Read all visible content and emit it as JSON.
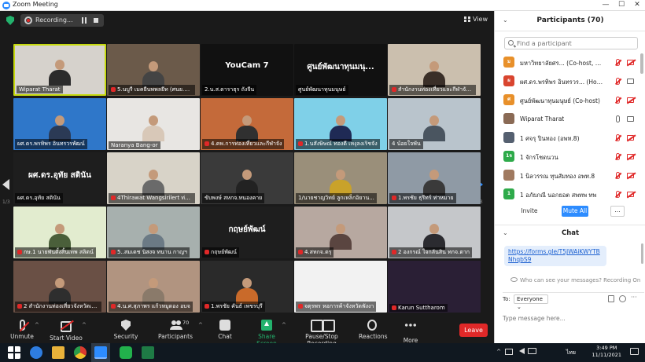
{
  "window": {
    "title": "Zoom Meeting",
    "minimize": "—",
    "maximize": "☐",
    "close": "✕"
  },
  "meeting_bar": {
    "recording_label": "Recording...",
    "view_label": "View"
  },
  "pagination": {
    "left_label": "1/3",
    "right_label": "1/3"
  },
  "tiles": [
    {
      "name": "Wiparat Tharat",
      "mic_off": false,
      "active": true,
      "bg": "#d6d2cc",
      "body": "#2b2b2b",
      "label": ""
    },
    {
      "name": "5.นบูรี เมคยีนพพลยีท (ศนย.พศ.ง...",
      "mic_off": true,
      "active": false,
      "bg": "#6b5a4a",
      "body": "#444",
      "label": ""
    },
    {
      "name": "2.น.ส.ดาราธุร ถังจีน",
      "mic_off": false,
      "active": false,
      "bg": "#111",
      "body": "",
      "label": "YouCam 7"
    },
    {
      "name": "ศูนย์พัฒนาทุนมนุษย์",
      "mic_off": false,
      "active": false,
      "bg": "#111",
      "body": "",
      "label": "ศูนย์พัฒนาทุนมนุ..."
    },
    {
      "name": "สำนักงานท่องเที่ยวและกีฬาจังหวั...",
      "mic_off": true,
      "active": false,
      "bg": "#cbbfae",
      "body": "#3a2f28",
      "label": ""
    },
    {
      "name": "ผศ.ดร.พรทิพร อินทรวรพัฒน์",
      "mic_off": false,
      "active": false,
      "bg": "#2f77c9",
      "body": "#2b3a55",
      "label": ""
    },
    {
      "name": "Naranya Bang-or",
      "mic_off": false,
      "active": false,
      "bg": "#e8e6e3",
      "body": "#d8c8b8",
      "label": ""
    },
    {
      "name": "4.คพ.การท่องเที่ยวและกีฬาจัง",
      "mic_off": true,
      "active": false,
      "bg": "#c46a3a",
      "body": "#303030",
      "label": ""
    },
    {
      "name": "1.นสังษิษณ์ ทองดี เหงุลงเริชจัง",
      "mic_off": true,
      "active": false,
      "bg": "#7fd0e8",
      "body": "#1f2a55",
      "label": ""
    },
    {
      "name": "4 น้อยใจพัน",
      "mic_off": false,
      "active": false,
      "bg": "#b9c4cc",
      "body": "#4a5560",
      "label": ""
    },
    {
      "name": "ผศ.ดร.อุทัย สตินัน",
      "mic_off": false,
      "active": false,
      "bg": "#1e1e1e",
      "body": "",
      "label": "ผศ.ดร.อุทัย สตินัน"
    },
    {
      "name": "4Thirawat Wangsiri​lert ท่อ...",
      "mic_off": true,
      "active": false,
      "bg": "#d8d3c8",
      "body": "#6a6a6a",
      "label": ""
    },
    {
      "name": "ขับพงษ์ สหกจ.หนองคาย",
      "mic_off": false,
      "active": false,
      "bg": "#3a3a3a",
      "body": "#222",
      "label": ""
    },
    {
      "name": "1/นายชาญวิทย์ ลูกเหล็กอิยาน...",
      "mic_off": false,
      "active": false,
      "bg": "#9a8f7a",
      "body": "#c9a22a",
      "label": ""
    },
    {
      "name": "1.พรชัย ธุรีทร์ ท่าหมาย",
      "mic_off": true,
      "active": false,
      "bg": "#8f9aa5",
      "body": "#3a3a3a",
      "label": ""
    },
    {
      "name": "กษ.1 นายพันตั้งสิ้นเทพ สลิตน์",
      "mic_off": true,
      "active": false,
      "bg": "#e2eccf",
      "body": "#4a5f3a",
      "label": ""
    },
    {
      "name": "5..สมเดช นิสงจ ทนาน กาญฯ",
      "mic_off": true,
      "active": false,
      "bg": "#a7b0ae",
      "body": "#6b7a85",
      "label": ""
    },
    {
      "name": "กฤษย์พัฒน์",
      "mic_off": true,
      "active": false,
      "bg": "#1e1e1e",
      "body": "",
      "label": "กฤษย์พัฒน์"
    },
    {
      "name": "4.สทกจ.ตรุ",
      "mic_off": true,
      "active": false,
      "bg": "#b7a8a0",
      "body": "#5a4540",
      "label": ""
    },
    {
      "name": "2 องกรณ์ ใจกลันสิน ทกจ.ตาก",
      "mic_off": true,
      "active": false,
      "bg": "#c5c7ca",
      "body": "#2b2b30",
      "label": ""
    },
    {
      "name": "2 สำนักงานท่องเที่ยวจังหวัดเพ็ชร",
      "mic_off": true,
      "active": false,
      "bg": "#6a5045",
      "body": "#2e2e2e",
      "label": ""
    },
    {
      "name": "4.น.ศ.สุภาพร แก้วหมูดอง อบจ",
      "mic_off": true,
      "active": false,
      "bg": "#b19480",
      "body": "#8a7a6a",
      "label": ""
    },
    {
      "name": "1.พรชัย คันธ์ เพชรบุรี",
      "mic_off": true,
      "active": false,
      "bg": "#2a2a2a",
      "body": "#c96a2a",
      "label": ""
    },
    {
      "name": "จตุรพร หอการค้าจังหวัดพังงา",
      "mic_off": true,
      "active": false,
      "bg": "#f2f2f2",
      "body": "",
      "label": ""
    },
    {
      "name": "Karun Suttharom",
      "mic_off": true,
      "active": false,
      "bg": "#2a1f35",
      "body": "",
      "label": ""
    }
  ],
  "toolbar": {
    "unmute": "Unmute",
    "start_video": "Start Video",
    "security": "Security",
    "participants": "Participants",
    "participants_count": "70",
    "chat": "Chat",
    "share_screen": "Share Screen",
    "pause_stop_recording": "Pause/Stop Recording",
    "reactions": "Reactions",
    "more": "More",
    "leave": "Leave"
  },
  "participants_panel": {
    "title": "Participants (70)",
    "search_placeholder": "Find a participant",
    "items": [
      {
        "avatar": "ม",
        "avatar_color": "#e8902a",
        "name": "มหาวิทยาลัยศร... (Co-host, me)",
        "mic": "off",
        "video": "off"
      },
      {
        "avatar": "ผ",
        "avatar_color": "#d9452f",
        "name": "ผศ.ดร.พรทิพร อินทรวร... (Host)",
        "mic": "off",
        "video": "on"
      },
      {
        "avatar": "ศ",
        "avatar_color": "#e8902a",
        "name": "ศูนย์พัฒนาทุนมนุษย์ (Co-host)",
        "mic": "off",
        "video": "off"
      },
      {
        "avatar": "",
        "avatar_color": "#8a6a55",
        "name": "Wiparat Tharat",
        "mic": "on",
        "video": "on"
      },
      {
        "avatar": "",
        "avatar_color": "#556070",
        "name": "1 ศจรุ ปินทอง (อพท.8)",
        "mic": "off",
        "video": "off"
      },
      {
        "avatar": "1จ",
        "avatar_color": "#2eaa4a",
        "name": "1 จักรโชดนวน",
        "mic": "off",
        "video": "off"
      },
      {
        "avatar": "",
        "avatar_color": "#a07a60",
        "name": "1 นิลวรรณ ทุนสัมทอง อพท.8",
        "mic": "off",
        "video": "off"
      },
      {
        "avatar": "1",
        "avatar_color": "#2eaa4a",
        "name": "1 อภัยภณี นอกยอต   สพทพ ทพ",
        "mic": "off",
        "video": "off"
      }
    ],
    "invite": "Invite",
    "mute_all": "Mute All",
    "more": "..."
  },
  "chat_panel": {
    "title": "Chat",
    "message": "https://forms.gle/T5JWAiKWYTBNhqbS9",
    "privacy_notice": "Who can see your messages? Recording On",
    "to_label": "To:",
    "to_value": "Everyone",
    "input_placeholder": "Type message here..."
  },
  "taskbar": {
    "language": "ไทย",
    "time": "3:49 PM",
    "date": "11/11/2021"
  },
  "colors": {
    "accent": "#2d8cff",
    "leave": "#e02828",
    "active_speaker": "#c6d90e",
    "share_green": "#23b26d"
  }
}
